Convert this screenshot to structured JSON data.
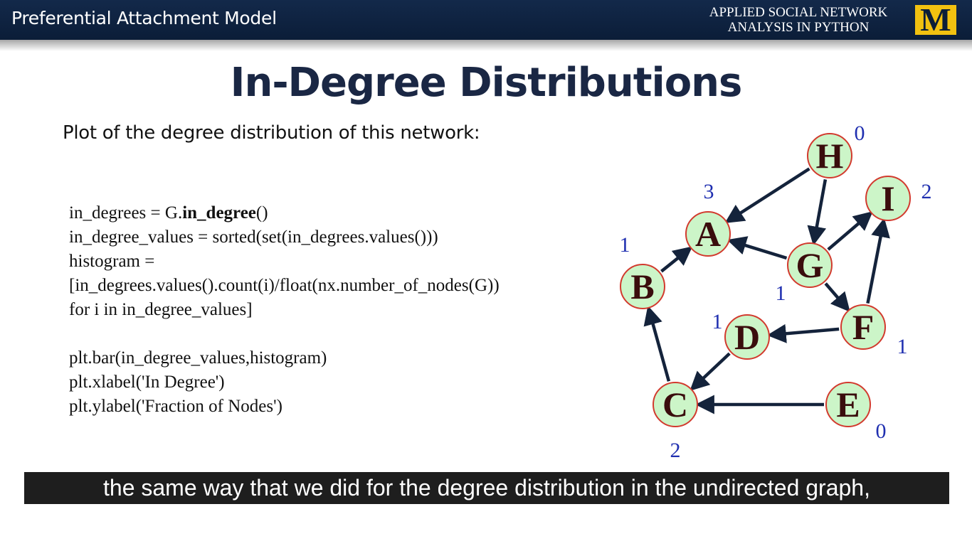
{
  "header": {
    "module_title": "Preferential Attachment Model",
    "course_title_line1": "APPLIED SOCIAL NETWORK",
    "course_title_line2": "ANALYSIS IN PYTHON",
    "logo_letter": "M",
    "bar_color": "#13294a",
    "logo_color": "#f2c110"
  },
  "slide": {
    "title": "In-Degree Distributions",
    "intro": "Plot of the degree distribution of this network:",
    "code": {
      "line1_prefix": "in_degrees = G.",
      "line1_bold": "in_degree",
      "line1_suffix": "()",
      "line2": "in_degree_values = sorted(set(in_degrees.values()))",
      "line3": "histogram =",
      "line4": "[in_degrees.values().count(i)/float(nx.number_of_nodes(G))",
      "line5": "for i in in_degree_values]",
      "line6": "plt.bar(in_degree_values,histogram)",
      "line7": "plt.xlabel('In Degree')",
      "line8": "plt.ylabel('Fraction of Nodes')"
    }
  },
  "graph": {
    "node_fill": "#ccf5c8",
    "node_stroke": "#d23a2e",
    "edge_color": "#14233b",
    "degree_label_color": "#1f2fb0",
    "nodes": [
      {
        "id": "H",
        "in_degree": "0"
      },
      {
        "id": "I",
        "in_degree": "2"
      },
      {
        "id": "A",
        "in_degree": "3"
      },
      {
        "id": "G",
        "in_degree": "1"
      },
      {
        "id": "B",
        "in_degree": "1"
      },
      {
        "id": "D",
        "in_degree": "1"
      },
      {
        "id": "F",
        "in_degree": "1"
      },
      {
        "id": "C",
        "in_degree": "2"
      },
      {
        "id": "E",
        "in_degree": "0"
      }
    ],
    "edges": [
      {
        "source": "H",
        "target": "A"
      },
      {
        "source": "H",
        "target": "G"
      },
      {
        "source": "G",
        "target": "A"
      },
      {
        "source": "G",
        "target": "I"
      },
      {
        "source": "G",
        "target": "F"
      },
      {
        "source": "F",
        "target": "I"
      },
      {
        "source": "F",
        "target": "D"
      },
      {
        "source": "D",
        "target": "C"
      },
      {
        "source": "E",
        "target": "C"
      },
      {
        "source": "C",
        "target": "B"
      },
      {
        "source": "B",
        "target": "A"
      }
    ]
  },
  "caption": "the same way that we did for the degree distribution in the undirected graph,"
}
